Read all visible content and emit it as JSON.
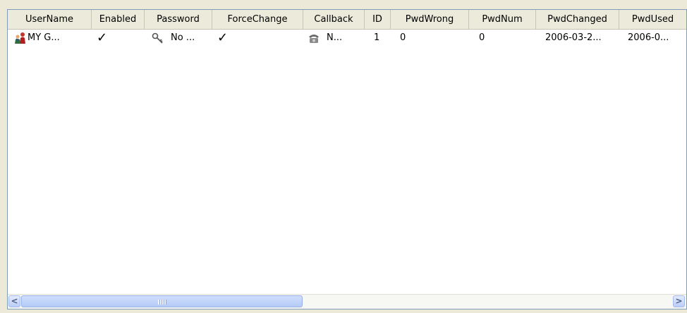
{
  "columns": [
    "UserName",
    "Enabled",
    "Password",
    "ForceChange",
    "Callback",
    "ID",
    "PwdWrong",
    "PwdNum",
    "PwdChanged",
    "PwdUsed"
  ],
  "rows": [
    {
      "username": "MY G...",
      "enabled": "✓",
      "password": "No ...",
      "force_change": "✓",
      "callback": "N...",
      "id": "1",
      "pwd_wrong": "0",
      "pwd_num": "0",
      "pwd_changed": "2006-03-2...",
      "pwd_used": "2006-0..."
    }
  ],
  "scrollbar": {
    "left_arrow": "<",
    "right_arrow": ">"
  }
}
